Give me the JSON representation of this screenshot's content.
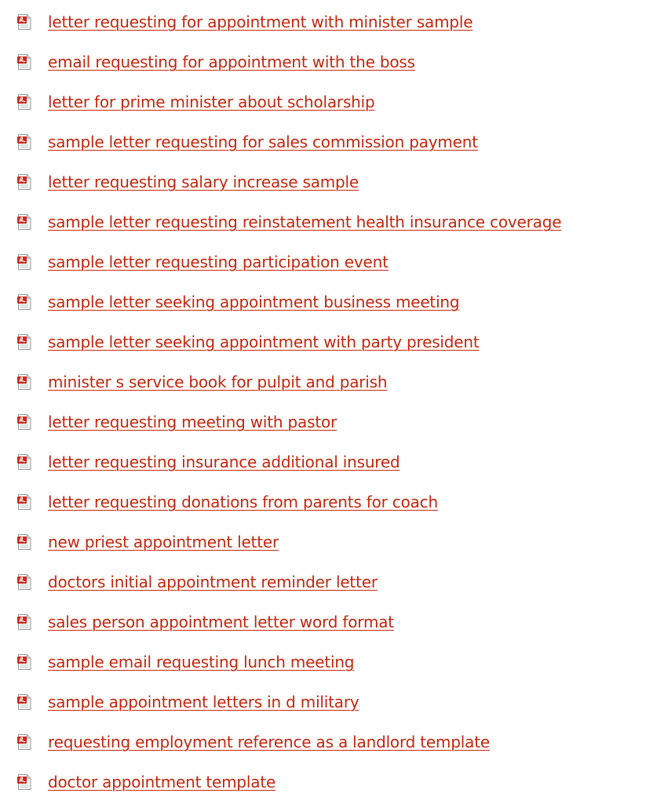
{
  "colors": {
    "link": "#c4260e",
    "icon_red": "#d0241b",
    "background": "#ffffff"
  },
  "icon": "pdf-document-icon",
  "documents": [
    "letter requesting for appointment with minister sample",
    "email requesting for appointment with the boss",
    "letter for prime minister about scholarship",
    "sample letter requesting for sales commission payment",
    "letter requesting salary increase sample",
    "sample letter requesting reinstatement health insurance coverage",
    "sample letter requesting participation event",
    "sample letter seeking appointment business meeting",
    "sample letter seeking appointment with party president",
    "minister s service book for pulpit and parish",
    "letter requesting meeting with pastor",
    "letter requesting insurance additional insured",
    "letter requesting donations from parents for coach",
    "new priest appointment letter",
    "doctors initial appointment reminder letter",
    "sales person appointment letter word format",
    "sample email requesting lunch meeting",
    "sample appointment letters in d military",
    "requesting employment reference as a landlord template",
    "doctor appointment template"
  ]
}
